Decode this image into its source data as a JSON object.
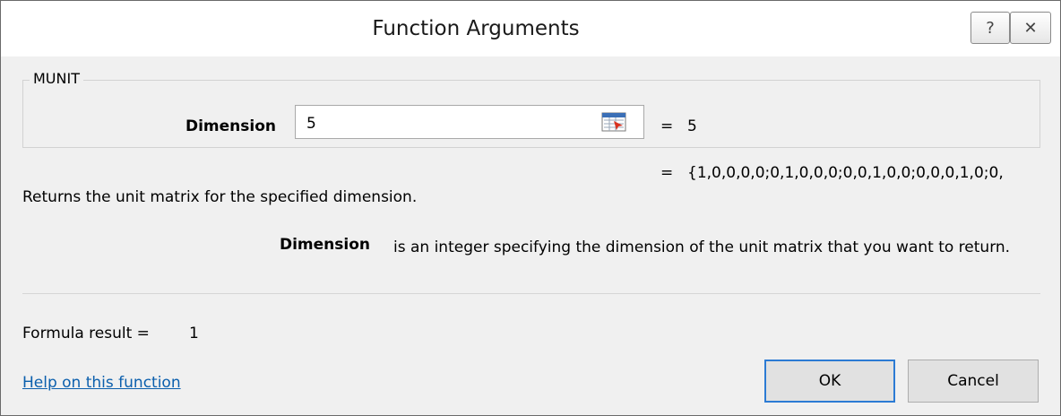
{
  "window": {
    "title": "Function Arguments",
    "help_glyph": "?",
    "close_glyph": "✕"
  },
  "function": {
    "name": "MUNIT",
    "argument": {
      "label": "Dimension",
      "value": "5",
      "equals": "=",
      "evaluated": "5",
      "ref_icon": "collapse-dialog-icon"
    },
    "result_equals": "=",
    "result_preview": "{1,0,0,0,0;0,1,0,0,0;0,0,1,0,0;0,0,0,1,0;0,",
    "description": "Returns the unit matrix for the specified dimension.",
    "arg_help_label": "Dimension",
    "arg_help_text": "is an integer specifying the dimension of the unit matrix that you want to return."
  },
  "formula": {
    "label": "Formula result =",
    "value": "1"
  },
  "footer": {
    "help_link": "Help on this function",
    "ok_label": "OK",
    "cancel_label": "Cancel"
  },
  "colors": {
    "link": "#0b5fad",
    "ok_border": "#2c7bd4",
    "dialog_bg": "#f0f0f0"
  }
}
